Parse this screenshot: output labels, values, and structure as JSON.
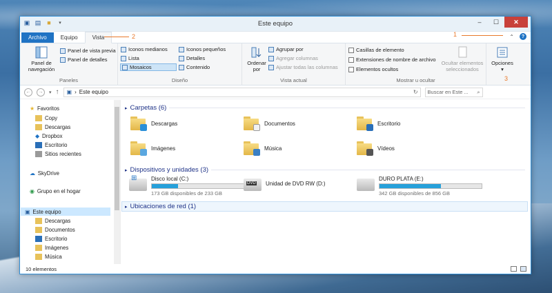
{
  "window": {
    "title": "Este equipo",
    "controls": [
      "–",
      "☐",
      "✕"
    ]
  },
  "tabs": [
    {
      "label": "Archivo"
    },
    {
      "label": "Equipo"
    },
    {
      "label": "Vista"
    }
  ],
  "annotations": [
    "1",
    "2",
    "3"
  ],
  "ribbon": {
    "panels": {
      "nav_pane": "Panel de navegación",
      "preview_pane": "Panel de vista previa",
      "details_pane": "Panel de detalles",
      "label": "Paneles"
    },
    "layout": {
      "items": [
        "Iconos medianos",
        "Iconos pequeños",
        "Lista",
        "Detalles",
        "Mosaicos",
        "Contenido"
      ],
      "selected": "Mosaicos",
      "label": "Diseño"
    },
    "current_view": {
      "sort_by": "Ordenar por",
      "group_by": "Agrupar por",
      "add_columns": "Agregar columnas",
      "fit_columns": "Ajustar todas las columnas",
      "label": "Vista actual"
    },
    "show_hide": {
      "item_checkboxes": "Casillas de elemento",
      "file_extensions": "Extensiones de nombre de archivo",
      "hidden_items": "Elementos ocultos",
      "hide_selected": "Ocultar elementos seleccionados",
      "label": "Mostrar u ocultar"
    },
    "options": "Opciones"
  },
  "address": {
    "path": "Este equipo",
    "search_placeholder": "Buscar en Este ..."
  },
  "nav": {
    "favorites": "Favoritos",
    "favorites_items": [
      "Copy",
      "Descargas",
      "Dropbox",
      "Escritorio",
      "Sitios recientes"
    ],
    "skydrive": "SkyDrive",
    "homegroup": "Grupo en el hogar",
    "this_pc": "Este equipo",
    "this_pc_items": [
      "Descargas",
      "Documentos",
      "Escritorio",
      "Imágenes",
      "Música"
    ]
  },
  "content": {
    "folders_header": "Carpetas (6)",
    "folders": [
      "Descargas",
      "Documentos",
      "Escritorio",
      "Imágenes",
      "Música",
      "Vídeos"
    ],
    "drives_header": "Dispositivos y unidades (3)",
    "drives": [
      {
        "name": "Disco local (C:)",
        "free": "173 GB disponibles de 233 GB",
        "used_fraction": 0.26
      },
      {
        "name": "Unidad de DVD RW (D:)",
        "free": "",
        "used_fraction": null
      },
      {
        "name": "DURO PLATA (E:)",
        "free": "342 GB disponibles de 856 GB",
        "used_fraction": 0.6
      }
    ],
    "network_header": "Ubicaciones de red (1)"
  },
  "status": {
    "count": "10 elementos"
  },
  "colors": {
    "accent": "#1f73c4",
    "close": "#c8413a",
    "annotation": "#e8782a",
    "bar_fill": "#26a0da"
  }
}
